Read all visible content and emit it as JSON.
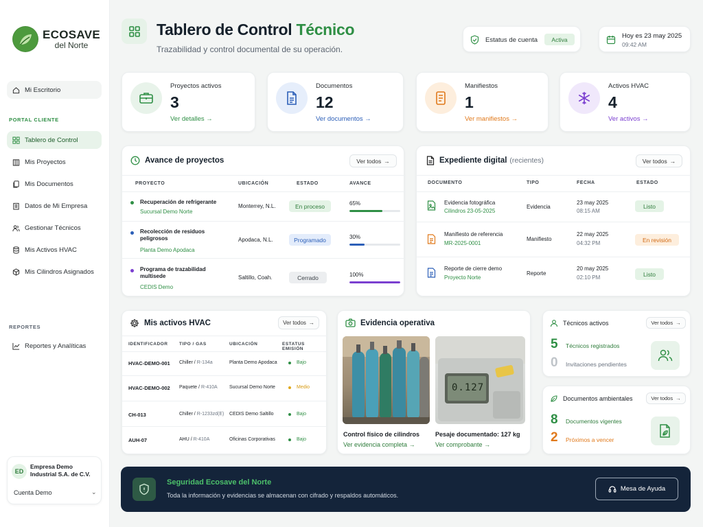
{
  "brand": {
    "name_top": "ECOSAVE",
    "name_bottom": "del Norte"
  },
  "sidebar": {
    "desk": "Mi Escritorio",
    "portal_title": "PORTAL CLIENTE",
    "items": [
      {
        "label": "Tablero de Control"
      },
      {
        "label": "Mis Proyectos"
      },
      {
        "label": "Mis Documentos"
      },
      {
        "label": "Datos de Mi Empresa"
      },
      {
        "label": "Gestionar Técnicos"
      },
      {
        "label": "Mis Activos HVAC"
      },
      {
        "label": "Mis Cilindros Asignados"
      }
    ],
    "reports_title": "REPORTES",
    "reports_item": "Reportes y Analíticas",
    "company": {
      "initials": "ED",
      "name": "Empresa Demo Industrial S.A. de C.V.",
      "account": "Cuenta Demo"
    }
  },
  "header": {
    "title_a": "Tablero de Control",
    "title_b": "Técnico",
    "subtitle": "Trazabilidad y control documental de su operación.",
    "status_label": "Estatus de cuenta",
    "status_value": "Activa",
    "date_line": "Hoy es 23 may 2025",
    "time": "09:42 AM"
  },
  "stats": [
    {
      "label": "Proyectos activos",
      "value": "3",
      "link": "Ver detalles"
    },
    {
      "label": "Documentos",
      "value": "12",
      "link": "Ver documentos"
    },
    {
      "label": "Manifiestos",
      "value": "1",
      "link": "Ver manifiestos"
    },
    {
      "label": "Activos HVAC",
      "value": "4",
      "link": "Ver activos"
    }
  ],
  "projects": {
    "title": "Avance de proyectos",
    "view_all": "Ver todos",
    "headers": [
      "PROYECTO",
      "UBICACIÓN",
      "ESTADO",
      "AVANCE"
    ],
    "rows": [
      {
        "name": "Recuperación de refrigerante",
        "site": "Sucursal Demo Norte",
        "location": "Monterrey, N.L.",
        "status": "En proceso",
        "progress_label": "65%",
        "progress": 65
      },
      {
        "name": "Recolección de residuos peligrosos",
        "site": "Planta Demo Apodaca",
        "location": "Apodaca, N.L.",
        "status": "Programado",
        "progress_label": "30%",
        "progress": 30
      },
      {
        "name": "Programa de trazabilidad multisede",
        "site": "CEDIS Demo",
        "location": "Saltillo, Coah.",
        "status": "Cerrado",
        "progress_label": "100%",
        "progress": 100
      }
    ]
  },
  "expediente": {
    "title": "Expediente digital",
    "title_note": "(recientes)",
    "view_all": "Ver todos",
    "headers": [
      "DOCUMENTO",
      "TIPO",
      "FECHA",
      "ESTADO"
    ],
    "rows": [
      {
        "name": "Evidencia fotográfica",
        "sub": "Cilindros 23-05-2025",
        "type": "Evidencia",
        "date": "23 may 2025",
        "time": "08:15 AM",
        "status": "Listo"
      },
      {
        "name": "Manifiesto de referencia",
        "sub": "MR-2025-0001",
        "type": "Manifiesto",
        "date": "22 may 2025",
        "time": "04:32 PM",
        "status": "En revisión"
      },
      {
        "name": "Reporte de cierre demo",
        "sub": "Proyecto Norte",
        "type": "Reporte",
        "date": "20 may 2025",
        "time": "02:10 PM",
        "status": "Listo"
      }
    ]
  },
  "hvac": {
    "title": "Mis activos HVAC",
    "view_all": "Ver todos",
    "headers": [
      "IDENTIFICADOR",
      "TIPO / GAS",
      "UBICACIÓN",
      "ESTATUS EMISIÓN"
    ],
    "rows": [
      {
        "id": "HVAC-DEMO-001",
        "type": "Chiller",
        "gas": "R-134a",
        "location": "Planta Demo Apodaca",
        "status": "Bajo"
      },
      {
        "id": "HVAC-DEMO-002",
        "type": "Paquete",
        "gas": "R-410A",
        "location": "Sucursal Demo Norte",
        "status": "Medio"
      },
      {
        "id": "CH-013",
        "type": "Chiller",
        "gas": "R-1233zd(E)",
        "location": "CEDIS Demo Saltillo",
        "status": "Bajo"
      },
      {
        "id": "AUH-07",
        "type": "AHU",
        "gas": "R-410A",
        "location": "Oficinas Corporativas",
        "status": "Bajo"
      }
    ]
  },
  "evidence": {
    "title": "Evidencia operativa",
    "items": [
      {
        "caption": "Control físico de cilindros",
        "link": "Ver evidencia completa"
      },
      {
        "caption": "Pesaje documentado: 127 kg",
        "link": "Ver comprobante"
      }
    ],
    "scale_reading": "0.127"
  },
  "techs": {
    "title": "Técnicos activos",
    "view_all": "Ver todos",
    "a_value": "5",
    "a_label": "Técnicos registrados",
    "b_value": "0",
    "b_label": "Invitaciones pendientes"
  },
  "envdocs": {
    "title": "Documentos ambientales",
    "view_all": "Ver todos",
    "a_value": "8",
    "a_label": "Documentos vigentes",
    "b_value": "2",
    "b_label": "Próximos a vencer"
  },
  "security": {
    "title": "Seguridad Ecosave del Norte",
    "text": "Toda la información y evidencias se almacenan con cifrado y respaldos automáticos.",
    "help": "Mesa de Ayuda"
  },
  "colors": {
    "green": "#2f8f45",
    "blue": "#2c5fb8",
    "orange": "#e0791b",
    "purple": "#7b3fd0",
    "navy": "#14243a"
  }
}
